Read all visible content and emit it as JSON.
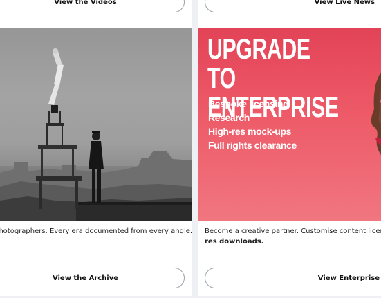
{
  "cards": {
    "videos": {
      "button_label": "View the Videos"
    },
    "live_news": {
      "button_label": "View Live News"
    },
    "archive": {
      "caption": "photographers. Every era documented from every angle.",
      "button_label": "View the Archive"
    },
    "enterprise": {
      "heading_line1": "UPGRADE TO",
      "heading_line2": "ENTERPRISE",
      "benefits": [
        "Bespoke licensing",
        "Research",
        "High-res mock-ups",
        "Full rights clearance"
      ],
      "caption_line1": "Become a creative partner. Customise content licenses",
      "caption_line2": "res downloads.",
      "button_label": "View Enterprise"
    }
  },
  "colors": {
    "promo_red": "#e24357",
    "page_background": "#eef0f3",
    "button_border": "#9aa0a6"
  }
}
